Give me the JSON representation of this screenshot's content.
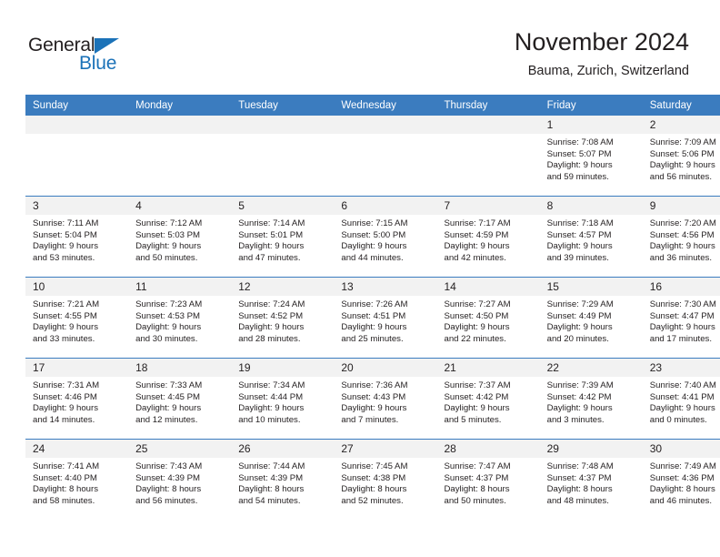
{
  "brand": {
    "name_part1": "General",
    "name_part2": "Blue",
    "accent_color": "#1b72b8"
  },
  "header": {
    "title": "November 2024",
    "subtitle": "Bauma, Zurich, Switzerland"
  },
  "theme": {
    "header_blue": "#3b7cbf",
    "daynum_bg": "#f2f2f2",
    "text": "#231f20"
  },
  "weekday_headers": [
    "Sunday",
    "Monday",
    "Tuesday",
    "Wednesday",
    "Thursday",
    "Friday",
    "Saturday"
  ],
  "weeks": [
    [
      {
        "day": "",
        "empty": true
      },
      {
        "day": "",
        "empty": true
      },
      {
        "day": "",
        "empty": true
      },
      {
        "day": "",
        "empty": true
      },
      {
        "day": "",
        "empty": true
      },
      {
        "day": "1",
        "sunrise": "Sunrise: 7:08 AM",
        "sunset": "Sunset: 5:07 PM",
        "daylight_line1": "Daylight: 9 hours",
        "daylight_line2": "and 59 minutes."
      },
      {
        "day": "2",
        "sunrise": "Sunrise: 7:09 AM",
        "sunset": "Sunset: 5:06 PM",
        "daylight_line1": "Daylight: 9 hours",
        "daylight_line2": "and 56 minutes."
      }
    ],
    [
      {
        "day": "3",
        "sunrise": "Sunrise: 7:11 AM",
        "sunset": "Sunset: 5:04 PM",
        "daylight_line1": "Daylight: 9 hours",
        "daylight_line2": "and 53 minutes."
      },
      {
        "day": "4",
        "sunrise": "Sunrise: 7:12 AM",
        "sunset": "Sunset: 5:03 PM",
        "daylight_line1": "Daylight: 9 hours",
        "daylight_line2": "and 50 minutes."
      },
      {
        "day": "5",
        "sunrise": "Sunrise: 7:14 AM",
        "sunset": "Sunset: 5:01 PM",
        "daylight_line1": "Daylight: 9 hours",
        "daylight_line2": "and 47 minutes."
      },
      {
        "day": "6",
        "sunrise": "Sunrise: 7:15 AM",
        "sunset": "Sunset: 5:00 PM",
        "daylight_line1": "Daylight: 9 hours",
        "daylight_line2": "and 44 minutes."
      },
      {
        "day": "7",
        "sunrise": "Sunrise: 7:17 AM",
        "sunset": "Sunset: 4:59 PM",
        "daylight_line1": "Daylight: 9 hours",
        "daylight_line2": "and 42 minutes."
      },
      {
        "day": "8",
        "sunrise": "Sunrise: 7:18 AM",
        "sunset": "Sunset: 4:57 PM",
        "daylight_line1": "Daylight: 9 hours",
        "daylight_line2": "and 39 minutes."
      },
      {
        "day": "9",
        "sunrise": "Sunrise: 7:20 AM",
        "sunset": "Sunset: 4:56 PM",
        "daylight_line1": "Daylight: 9 hours",
        "daylight_line2": "and 36 minutes."
      }
    ],
    [
      {
        "day": "10",
        "sunrise": "Sunrise: 7:21 AM",
        "sunset": "Sunset: 4:55 PM",
        "daylight_line1": "Daylight: 9 hours",
        "daylight_line2": "and 33 minutes."
      },
      {
        "day": "11",
        "sunrise": "Sunrise: 7:23 AM",
        "sunset": "Sunset: 4:53 PM",
        "daylight_line1": "Daylight: 9 hours",
        "daylight_line2": "and 30 minutes."
      },
      {
        "day": "12",
        "sunrise": "Sunrise: 7:24 AM",
        "sunset": "Sunset: 4:52 PM",
        "daylight_line1": "Daylight: 9 hours",
        "daylight_line2": "and 28 minutes."
      },
      {
        "day": "13",
        "sunrise": "Sunrise: 7:26 AM",
        "sunset": "Sunset: 4:51 PM",
        "daylight_line1": "Daylight: 9 hours",
        "daylight_line2": "and 25 minutes."
      },
      {
        "day": "14",
        "sunrise": "Sunrise: 7:27 AM",
        "sunset": "Sunset: 4:50 PM",
        "daylight_line1": "Daylight: 9 hours",
        "daylight_line2": "and 22 minutes."
      },
      {
        "day": "15",
        "sunrise": "Sunrise: 7:29 AM",
        "sunset": "Sunset: 4:49 PM",
        "daylight_line1": "Daylight: 9 hours",
        "daylight_line2": "and 20 minutes."
      },
      {
        "day": "16",
        "sunrise": "Sunrise: 7:30 AM",
        "sunset": "Sunset: 4:47 PM",
        "daylight_line1": "Daylight: 9 hours",
        "daylight_line2": "and 17 minutes."
      }
    ],
    [
      {
        "day": "17",
        "sunrise": "Sunrise: 7:31 AM",
        "sunset": "Sunset: 4:46 PM",
        "daylight_line1": "Daylight: 9 hours",
        "daylight_line2": "and 14 minutes."
      },
      {
        "day": "18",
        "sunrise": "Sunrise: 7:33 AM",
        "sunset": "Sunset: 4:45 PM",
        "daylight_line1": "Daylight: 9 hours",
        "daylight_line2": "and 12 minutes."
      },
      {
        "day": "19",
        "sunrise": "Sunrise: 7:34 AM",
        "sunset": "Sunset: 4:44 PM",
        "daylight_line1": "Daylight: 9 hours",
        "daylight_line2": "and 10 minutes."
      },
      {
        "day": "20",
        "sunrise": "Sunrise: 7:36 AM",
        "sunset": "Sunset: 4:43 PM",
        "daylight_line1": "Daylight: 9 hours",
        "daylight_line2": "and 7 minutes."
      },
      {
        "day": "21",
        "sunrise": "Sunrise: 7:37 AM",
        "sunset": "Sunset: 4:42 PM",
        "daylight_line1": "Daylight: 9 hours",
        "daylight_line2": "and 5 minutes."
      },
      {
        "day": "22",
        "sunrise": "Sunrise: 7:39 AM",
        "sunset": "Sunset: 4:42 PM",
        "daylight_line1": "Daylight: 9 hours",
        "daylight_line2": "and 3 minutes."
      },
      {
        "day": "23",
        "sunrise": "Sunrise: 7:40 AM",
        "sunset": "Sunset: 4:41 PM",
        "daylight_line1": "Daylight: 9 hours",
        "daylight_line2": "and 0 minutes."
      }
    ],
    [
      {
        "day": "24",
        "sunrise": "Sunrise: 7:41 AM",
        "sunset": "Sunset: 4:40 PM",
        "daylight_line1": "Daylight: 8 hours",
        "daylight_line2": "and 58 minutes."
      },
      {
        "day": "25",
        "sunrise": "Sunrise: 7:43 AM",
        "sunset": "Sunset: 4:39 PM",
        "daylight_line1": "Daylight: 8 hours",
        "daylight_line2": "and 56 minutes."
      },
      {
        "day": "26",
        "sunrise": "Sunrise: 7:44 AM",
        "sunset": "Sunset: 4:39 PM",
        "daylight_line1": "Daylight: 8 hours",
        "daylight_line2": "and 54 minutes."
      },
      {
        "day": "27",
        "sunrise": "Sunrise: 7:45 AM",
        "sunset": "Sunset: 4:38 PM",
        "daylight_line1": "Daylight: 8 hours",
        "daylight_line2": "and 52 minutes."
      },
      {
        "day": "28",
        "sunrise": "Sunrise: 7:47 AM",
        "sunset": "Sunset: 4:37 PM",
        "daylight_line1": "Daylight: 8 hours",
        "daylight_line2": "and 50 minutes."
      },
      {
        "day": "29",
        "sunrise": "Sunrise: 7:48 AM",
        "sunset": "Sunset: 4:37 PM",
        "daylight_line1": "Daylight: 8 hours",
        "daylight_line2": "and 48 minutes."
      },
      {
        "day": "30",
        "sunrise": "Sunrise: 7:49 AM",
        "sunset": "Sunset: 4:36 PM",
        "daylight_line1": "Daylight: 8 hours",
        "daylight_line2": "and 46 minutes."
      }
    ]
  ]
}
